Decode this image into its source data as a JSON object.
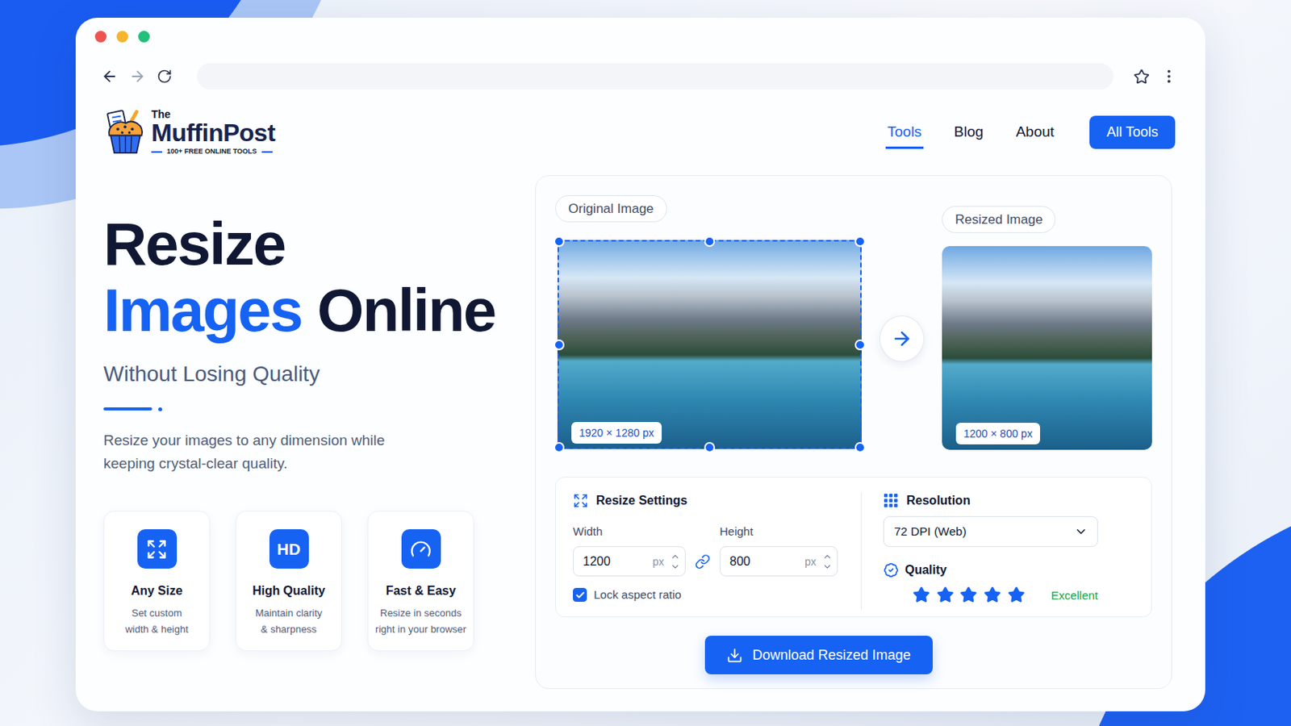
{
  "window_controls": [
    {
      "color": "#ef5350"
    },
    {
      "color": "#f5b52e"
    },
    {
      "color": "#22c07a"
    }
  ],
  "logo": {
    "prefix": "The",
    "name": "MuffinPost",
    "tagline": "100+ FREE ONLINE TOOLS"
  },
  "nav": [
    {
      "label": "Tools",
      "selected": true
    },
    {
      "label": "Blog",
      "selected": false
    },
    {
      "label": "About",
      "selected": false
    }
  ],
  "nav_button": "All Tools",
  "hero": {
    "title_first": "Resize",
    "title_highlight": "Images",
    "title_rest": "Online",
    "subtitle": "Without Losing Quality",
    "description_lines": [
      "Resize your images to any dimension while",
      "keeping crystal-clear quality."
    ]
  },
  "features": [
    {
      "kind": "expand",
      "badge": "",
      "title": "Any Size",
      "desc_lines": [
        "Set custom",
        "width & height"
      ]
    },
    {
      "kind": "badge",
      "badge": "HD",
      "title": "High Quality",
      "desc_lines": [
        "Maintain clarity",
        "& sharpness"
      ]
    },
    {
      "kind": "gauge",
      "badge": "",
      "title": "Fast & Easy",
      "desc_lines": [
        "Resize in seconds",
        "right in your browser"
      ]
    }
  ],
  "editor": {
    "original": {
      "label": "Original Image",
      "size": "1920 × 1280 px"
    },
    "resized": {
      "label": "Resized Image",
      "size": "1200 × 800 px"
    }
  },
  "settings": {
    "title": "Resize Settings",
    "fields": [
      {
        "label": "Width",
        "value": "1200",
        "unit": "px"
      },
      {
        "label": "Height",
        "value": "800",
        "unit": "px"
      }
    ],
    "lock": {
      "label": "Lock aspect ratio",
      "checked": true
    }
  },
  "resolution": {
    "title": "Resolution",
    "value": "72 DPI (Web)"
  },
  "quality": {
    "title": "Quality",
    "stars": 5,
    "rating": "Excellent"
  },
  "download": "Download Resized Image"
}
